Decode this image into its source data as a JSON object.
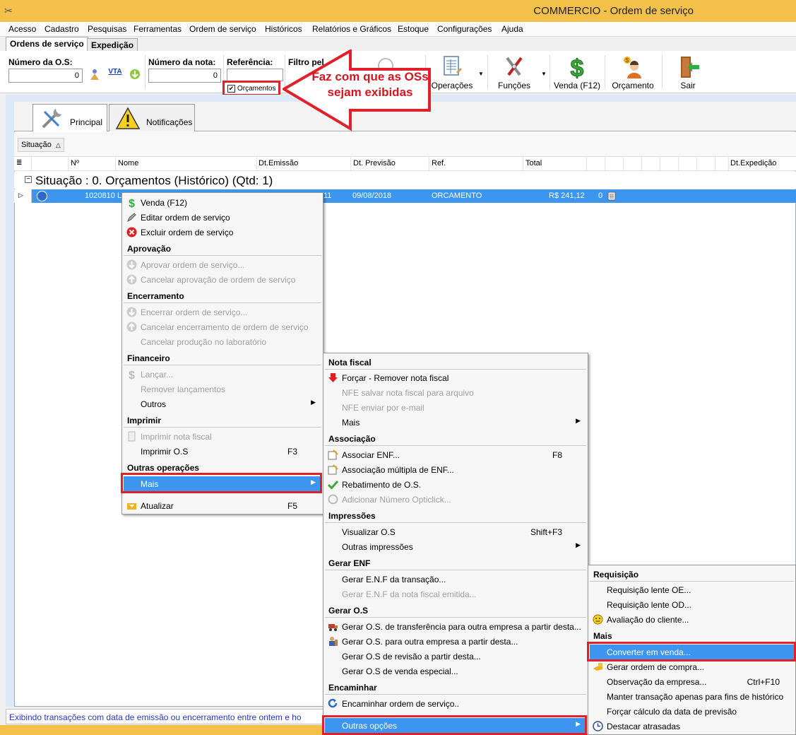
{
  "window": {
    "title": "COMMERCIO - Ordem de serviço"
  },
  "menubar": [
    "Acesso",
    "Cadastro",
    "Pesquisas",
    "Ferramentas",
    "Ordem de serviço",
    "Históricos",
    "Relatórios e Gráficos",
    "Estoque",
    "Configurações",
    "Ajuda"
  ],
  "doc_tabs": [
    "Ordens de serviço",
    "Expedição"
  ],
  "toolbar": {
    "os_label": "Número da O.S:",
    "os_value": "0",
    "vta": "VTA",
    "nota_label": "Número da nota:",
    "nota_value": "0",
    "ref_label": "Referência:",
    "filtro_label": "Filtro pel",
    "checkbox_label": "Orçamentos",
    "checkbox_checked": true,
    "checkbox_mark": "✔",
    "buttons": {
      "operacoes": "Operações",
      "funcoes": "Funções",
      "venda": "Venda (F12)",
      "orcamento": "Orçamento",
      "sair": "Sair"
    }
  },
  "callout": {
    "text": "Faz com que as OSs sejam exibidas"
  },
  "panel_tabs": [
    "Principal",
    "Notificações"
  ],
  "group_chip": {
    "label": "Situação",
    "sort": "△"
  },
  "grid": {
    "columns": [
      "Nº",
      "Nome",
      "Dt.Emissão",
      "Dt. Previsão",
      "Ref.",
      "Total",
      "Dt.Expedição"
    ],
    "menu_glyph": "≣",
    "group_toggle": "−",
    "group_label": "Situação : 0. Orçamentos (Histórico) (Qtd: 1)",
    "row": {
      "selector": "▷",
      "numero": "1020810",
      "nome": "L",
      "emissao": "11",
      "previsao": "09/08/2018",
      "ref": "ORCAMENTO",
      "total": "R$ 241,12",
      "extra": "0"
    }
  },
  "status": {
    "text": "Exibindo transações com data de emissão ou encerramento entre ontem e ho"
  },
  "context_menu": {
    "venda": "Venda (F12)",
    "editar": "Editar ordem de serviço",
    "excluir": "Excluir ordem de serviço",
    "aprovacao": "Aprovação",
    "aprovar": "Aprovar ordem de serviço...",
    "cancelar_aprov": "Cancelar aprovação de ordem de serviço",
    "encerramento": "Encerramento",
    "encerrar": "Encerrar ordem de serviço...",
    "cancelar_enc": "Cancelar encerramento de ordem de serviço",
    "cancelar_prod": "Cancelar produção no laboratório",
    "financeiro": "Financeiro",
    "lancar": "Lançar...",
    "remover_lanc": "Remover lançamentos",
    "outros": "Outros",
    "imprimir_h": "Imprimir",
    "imprimir_nf": "Imprimir nota fiscal",
    "imprimir_os": "Imprimir O.S",
    "imprimir_os_sc": "F3",
    "outras_op": "Outras operações",
    "mais": "Mais",
    "atualizar": "Atualizar",
    "atualizar_sc": "F5",
    "arrow": "▶"
  },
  "submenu": {
    "nota_fiscal": "Nota fiscal",
    "forcar": "Forçar - Remover nota fiscal",
    "nfe_salvar": "NFE salvar nota fiscal para arquivo",
    "nfe_email": "NFE enviar por e-mail",
    "mais": "Mais",
    "associacao": "Associação",
    "assoc_enf": "Associar ENF...",
    "assoc_enf_sc": "F8",
    "assoc_mult": "Associação múltipla de ENF...",
    "rebatimento": "Rebatimento de O.S.",
    "opticlick": "Adicionar Número Opticlick...",
    "impressoes": "Impressões",
    "visualizar": "Visualizar O.S",
    "visualizar_sc": "Shift+F3",
    "outras_imp": "Outras impressões",
    "gerar_enf": "Gerar ENF",
    "enf_trans": "Gerar E.N.F da transação...",
    "enf_nota": "Gerar E.N.F da nota fiscal emitida...",
    "gerar_os": "Gerar O.S",
    "os_transf": "Gerar O.S. de transferência para outra empresa a partir desta...",
    "os_outra": "Gerar O.S. para outra empresa a partir desta...",
    "os_revisao": "Gerar O.S de revisão a partir desta...",
    "os_especial": "Gerar O.S de venda especial...",
    "encaminhar": "Encaminhar",
    "encaminhar_os": "Encaminhar ordem de serviço..",
    "outras_opcoes": "Outras opções"
  },
  "submenu2": {
    "requisicao": "Requisição",
    "req_oe": "Requisição lente OE...",
    "req_od": "Requisição lente OD...",
    "avaliacao": "Avaliação do cliente...",
    "mais": "Mais",
    "converter": "Converter em venda...",
    "compra": "Gerar ordem de compra...",
    "observacao": "Observação da empresa...",
    "observacao_sc": "Ctrl+F10",
    "manter": "Manter transação apenas para fins de histórico",
    "forcar_calc": "Forçar cálculo da data de previsão",
    "destacar": "Destacar atrasadas"
  },
  "colors": {
    "selection": "#3c96f0",
    "titlebar": "#f3c04a",
    "highlight_box": "#e0202a",
    "status_text": "#2338c8"
  }
}
